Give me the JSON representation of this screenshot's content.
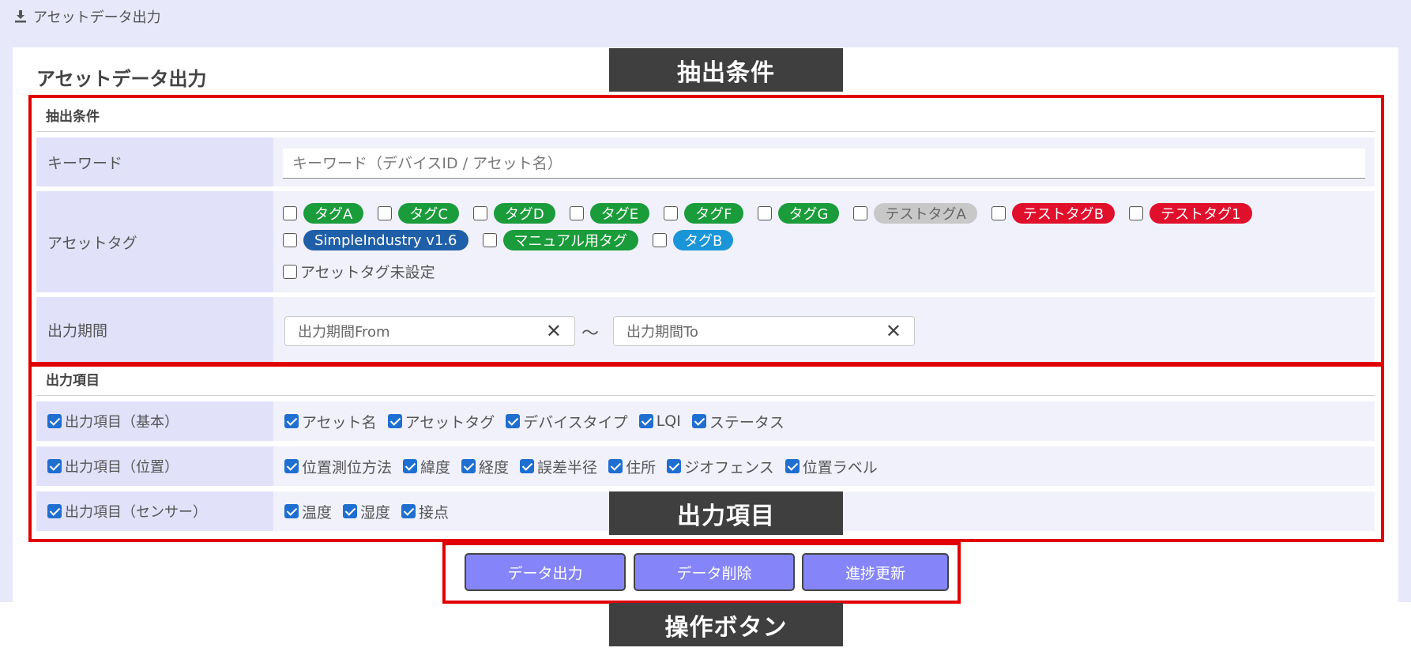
{
  "breadcrumb": {
    "label": "アセットデータ出力"
  },
  "page": {
    "title": "アセットデータ出力"
  },
  "extract": {
    "section_label": "抽出条件",
    "keyword": {
      "label": "キーワード",
      "placeholder": "キーワード（デバイスID / アセット名）",
      "value": ""
    },
    "tags": {
      "label": "アセットタグ",
      "items": [
        {
          "label": "タグA",
          "color": "#1a9c3a",
          "checked": false
        },
        {
          "label": "タグC",
          "color": "#1a9c3a",
          "checked": false
        },
        {
          "label": "タグD",
          "color": "#1a9c3a",
          "checked": false
        },
        {
          "label": "タグE",
          "color": "#1a9c3a",
          "checked": false
        },
        {
          "label": "タグF",
          "color": "#1a9c3a",
          "checked": false
        },
        {
          "label": "タグG",
          "color": "#1a9c3a",
          "checked": false
        },
        {
          "label": "テストタグA",
          "color": "#c8c8c8",
          "checked": false
        },
        {
          "label": "テストタグB",
          "color": "#e0102c",
          "checked": false
        },
        {
          "label": "テストタグ1",
          "color": "#e0102c",
          "checked": false
        },
        {
          "label": "SimpleIndustry v1.6",
          "color": "#1f5fa8",
          "checked": false
        },
        {
          "label": "マニュアル用タグ",
          "color": "#1a9c3a",
          "checked": false
        },
        {
          "label": "タグB",
          "color": "#1a96d8",
          "checked": false
        }
      ],
      "unset_label": "アセットタグ未設定"
    },
    "period": {
      "label": "出力期間",
      "from_placeholder": "出力期間From",
      "to_placeholder": "出力期間To",
      "separator": "～"
    }
  },
  "output": {
    "section_label": "出力項目",
    "groups": [
      {
        "label": "出力項目（基本）",
        "checked": true,
        "options": [
          "アセット名",
          "アセットタグ",
          "デバイスタイプ",
          "LQI",
          "ステータス"
        ]
      },
      {
        "label": "出力項目（位置）",
        "checked": true,
        "options": [
          "位置測位方法",
          "緯度",
          "経度",
          "誤差半径",
          "住所",
          "ジオフェンス",
          "位置ラベル"
        ]
      },
      {
        "label": "出力項目（センサー）",
        "checked": true,
        "options": [
          "温度",
          "湿度",
          "接点"
        ]
      }
    ]
  },
  "buttons": {
    "export": "データ出力",
    "delete": "データ削除",
    "progress": "進捗更新"
  },
  "callouts": {
    "extract": "抽出条件",
    "output": "出力項目",
    "buttons": "操作ボタン"
  },
  "colors": {
    "highlight_red": "#e00000",
    "button_blue": "#8585f9",
    "callout_bg": "#3f3f3f"
  }
}
